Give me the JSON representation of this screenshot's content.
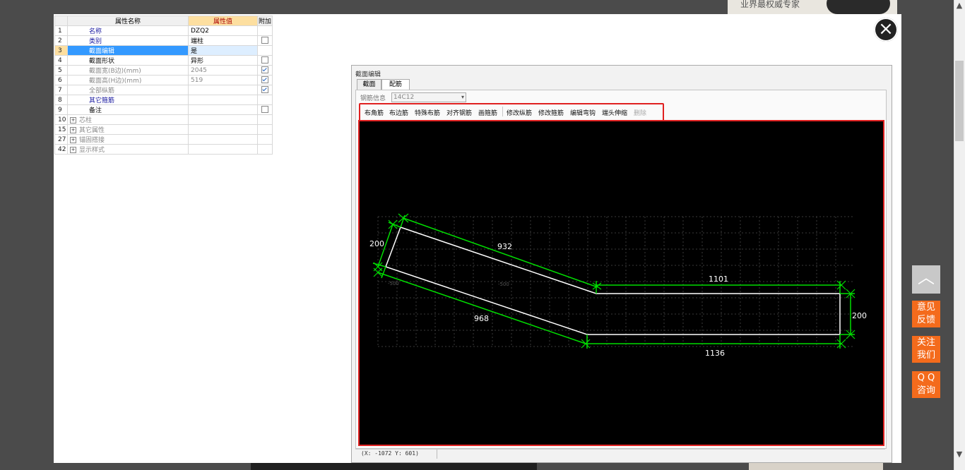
{
  "background": {
    "top_right_text": "业界最权威专家"
  },
  "property_table": {
    "headers": {
      "num": "",
      "name": "属性名称",
      "value": "属性值",
      "extra": "附加"
    },
    "rows": [
      {
        "num": "1",
        "name": "名称",
        "value": "DZQ2",
        "style": "blue",
        "check": "none"
      },
      {
        "num": "2",
        "name": "类别",
        "value": "端柱",
        "style": "blue",
        "check": "off"
      },
      {
        "num": "3",
        "name": "截面编辑",
        "value": "是",
        "style": "sel",
        "check": "none"
      },
      {
        "num": "4",
        "name": "截面形状",
        "value": "异形",
        "style": "black",
        "check": "off"
      },
      {
        "num": "5",
        "name": "截面宽(B边)(mm)",
        "value": "2045",
        "style": "gray",
        "check": "on"
      },
      {
        "num": "6",
        "name": "截面高(H边)(mm)",
        "value": "519",
        "style": "gray",
        "check": "on"
      },
      {
        "num": "7",
        "name": "全部纵筋",
        "value": "",
        "style": "gray",
        "check": "on"
      },
      {
        "num": "8",
        "name": "其它箍筋",
        "value": "",
        "style": "blue",
        "check": "none"
      },
      {
        "num": "9",
        "name": "备注",
        "value": "",
        "style": "black",
        "check": "off"
      },
      {
        "num": "10",
        "name": "芯柱",
        "value": "",
        "style": "group",
        "check": "none"
      },
      {
        "num": "15",
        "name": "其它属性",
        "value": "",
        "style": "group",
        "check": "none"
      },
      {
        "num": "27",
        "name": "锚固搭接",
        "value": "",
        "style": "group",
        "check": "none"
      },
      {
        "num": "42",
        "name": "显示样式",
        "value": "",
        "style": "group",
        "check": "none"
      }
    ]
  },
  "close_icon": "×",
  "dialog": {
    "title": "截面编辑",
    "tabs": [
      "截面",
      "配筋"
    ],
    "rebar_info_label": "钢筋信息",
    "rebar_info_value": "14C12",
    "toolbar": [
      "布角筋",
      "布边筋",
      "特殊布筋",
      "对齐钢筋",
      "画箍筋",
      "修改纵筋",
      "修改箍筋",
      "编辑弯钩",
      "端头伸缩",
      "删除"
    ],
    "canvas": {
      "dims": {
        "top_diag": "932",
        "left": "200",
        "bottom_diag": "968",
        "top_right": "1101",
        "right": "200",
        "bottom_right": "1136"
      },
      "axis_labels": {
        "left_axis": "-500",
        "mid_axis": "-500"
      }
    },
    "status_coord": "(X: -1072 Y: 601)"
  },
  "side_panel": {
    "back_top_icon": "︿",
    "feedback": [
      "意见",
      "反馈"
    ],
    "follow": [
      "关注",
      "我们"
    ],
    "qq": [
      "Q Q",
      "咨询"
    ]
  },
  "colors": {
    "accent": "#f46b1c",
    "highlight_border": "#e02020",
    "dimension_line": "#00dd00",
    "section_outline": "#ffffff"
  }
}
